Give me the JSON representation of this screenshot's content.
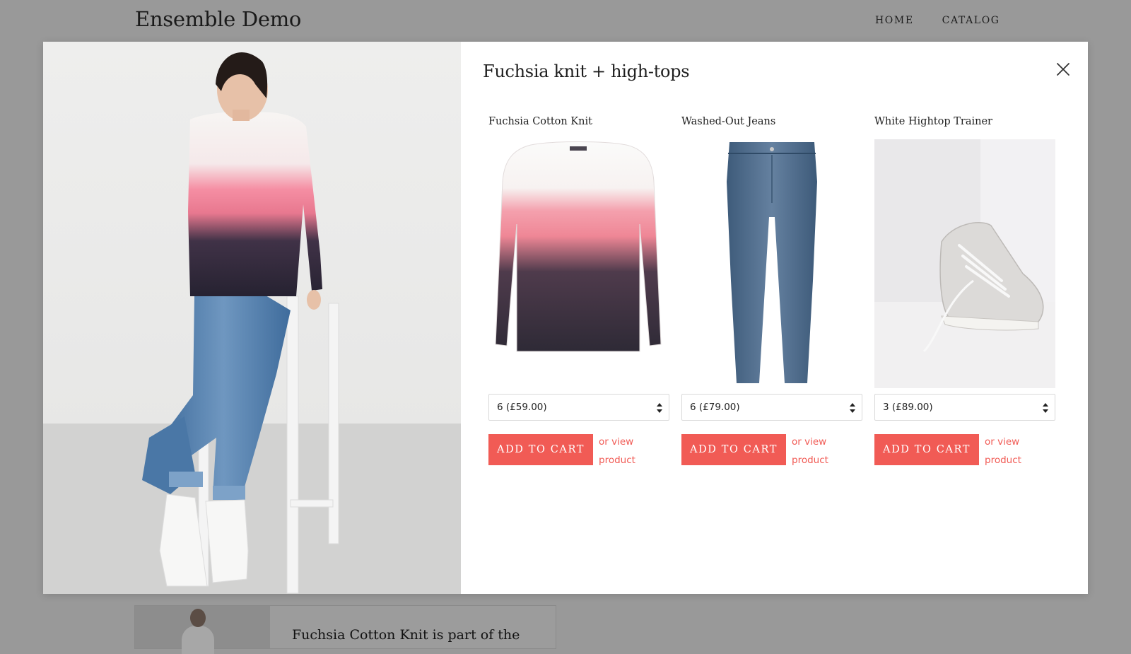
{
  "site": {
    "title": "Ensemble Demo",
    "nav": [
      "HOME",
      "CATALOG"
    ]
  },
  "background_card": {
    "text": "Fuchsia Cotton Knit is part of the"
  },
  "modal": {
    "title": "Fuchsia knit + high-tops",
    "close_icon": "close-icon",
    "products": [
      {
        "name": "Fuchsia Cotton Knit",
        "selected_option": "6 (£59.00)",
        "add_label": "ADD TO CART",
        "view_link": "or view product"
      },
      {
        "name": "Washed-Out Jeans",
        "selected_option": "6 (£79.00)",
        "add_label": "ADD TO CART",
        "view_link": "or view product"
      },
      {
        "name": "White Hightop Trainer",
        "selected_option": "3 (£89.00)",
        "add_label": "ADD TO CART",
        "view_link": "or view product"
      }
    ]
  },
  "colors": {
    "accent": "#f15b55",
    "overlay": "#999999",
    "modal_bg": "#ffffff"
  }
}
